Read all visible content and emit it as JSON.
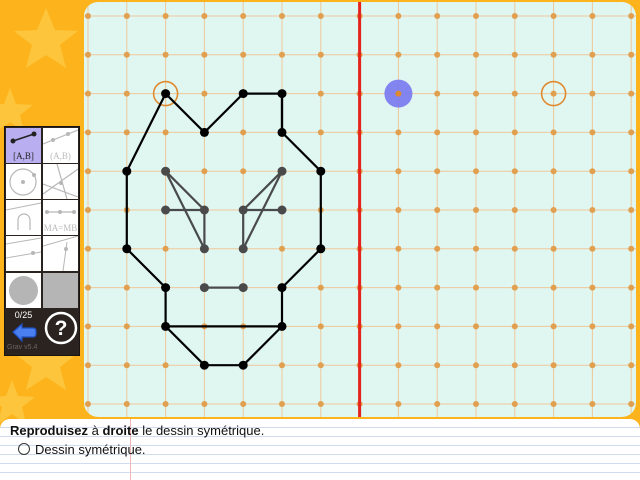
{
  "colors": {
    "background": "#fdb41c",
    "board": "#dff6f1",
    "grid_line": "#f0c89a",
    "grid_dot": "#e0a050",
    "axis": "#e5231c",
    "drawing": "#000000",
    "drawing_inner": "#4a4a4a",
    "cursor": "#7878f0",
    "tool_active": "#b8aef0"
  },
  "toolbox": {
    "tools": [
      {
        "label": "[A,B]",
        "icon": "segment-icon",
        "active": true
      },
      {
        "label": "(A,B)",
        "icon": "line-icon",
        "active": false
      },
      {
        "label": "",
        "icon": "circle-icon",
        "active": false
      },
      {
        "label": "",
        "icon": "lines-icon",
        "active": false
      },
      {
        "label": "",
        "icon": "compass-icon",
        "active": false
      },
      {
        "label": "MA=MB",
        "icon": "midpoint-icon",
        "active": false
      },
      {
        "label": "",
        "icon": "intersection-icon",
        "active": false
      },
      {
        "label": "",
        "icon": "ray-icon",
        "active": false
      }
    ],
    "counter": "0/25",
    "version": "Grav v5.4"
  },
  "instructions": {
    "verb": "Reproduisez",
    "middle": " à ",
    "side": "droite",
    "rest": " le dessin symétrique.",
    "task": "Dessin symétrique."
  }
}
